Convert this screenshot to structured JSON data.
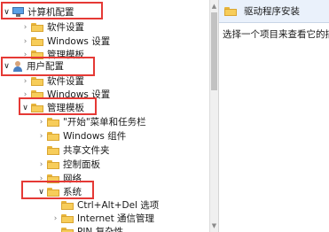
{
  "tree": {
    "computer_config": {
      "label": "计算机配置"
    },
    "computer_children": [
      {
        "label": "软件设置"
      },
      {
        "label": "Windows 设置"
      },
      {
        "label": "管理模板"
      }
    ],
    "user_config": {
      "label": "用户配置"
    },
    "user_children": [
      {
        "label": "软件设置"
      },
      {
        "label": "Windows 设置"
      }
    ],
    "admin_templates": {
      "label": "管理模板"
    },
    "admin_children": [
      {
        "label": "\"开始\"菜单和任务栏"
      },
      {
        "label": "Windows 组件"
      },
      {
        "label": "共享文件夹"
      },
      {
        "label": "控制面板"
      },
      {
        "label": "网络"
      }
    ],
    "system": {
      "label": "系统"
    },
    "system_children": [
      {
        "label": "Ctrl+Alt+Del 选项"
      },
      {
        "label": "Internet 通信管理"
      },
      {
        "label": "PIN 复杂性"
      }
    ]
  },
  "right_pane": {
    "title": "驱动程序安装",
    "description": "选择一个项目来查看它的描述"
  },
  "colors": {
    "highlight_box": "#e53935",
    "folder": "#f7cd5a",
    "header_bg": "#eaf1fb"
  }
}
